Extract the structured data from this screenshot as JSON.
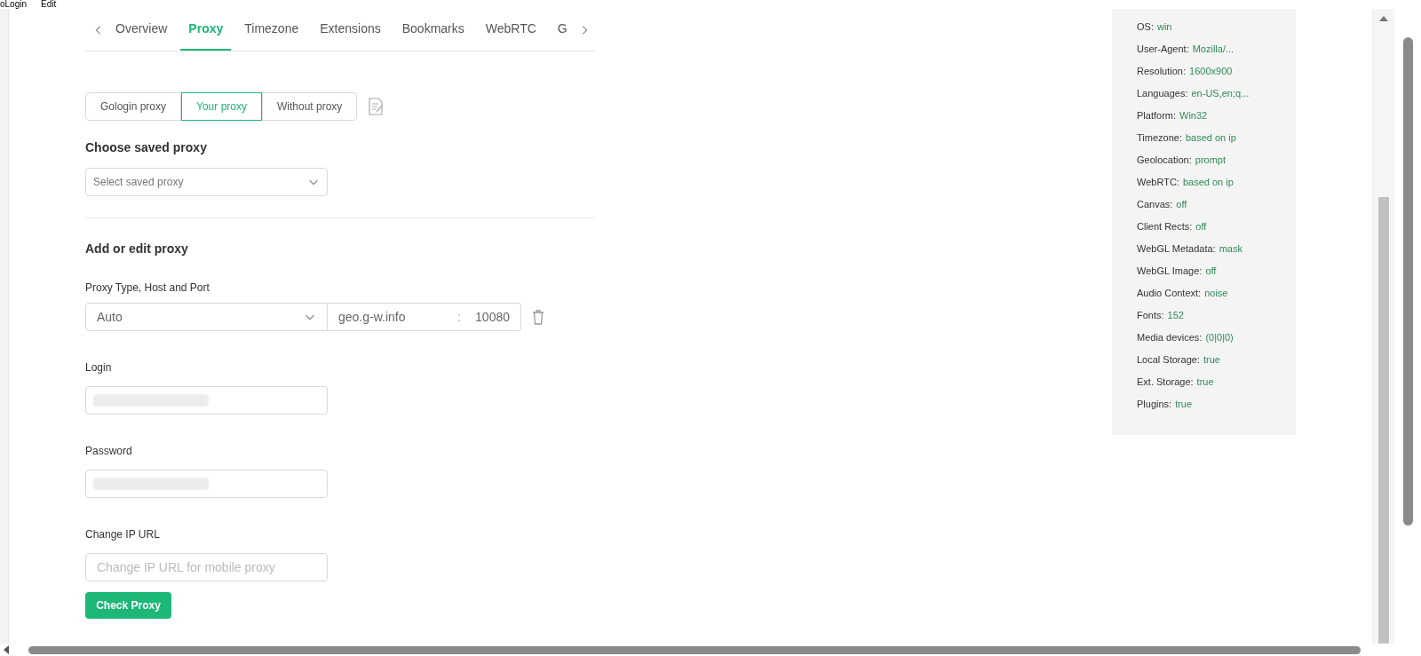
{
  "menu": [
    "oLogin",
    "Edit"
  ],
  "tabs": [
    {
      "label": "Overview",
      "selected": false
    },
    {
      "label": "Proxy",
      "selected": true
    },
    {
      "label": "Timezone",
      "selected": false
    },
    {
      "label": "Extensions",
      "selected": false
    },
    {
      "label": "Bookmarks",
      "selected": false
    },
    {
      "label": "WebRTC",
      "selected": false
    },
    {
      "label": "G",
      "selected": false
    }
  ],
  "proxy_modes": [
    {
      "label": "Gologin proxy",
      "selected": false
    },
    {
      "label": "Your proxy",
      "selected": true
    },
    {
      "label": "Without proxy",
      "selected": false
    }
  ],
  "saved_proxy": {
    "heading": "Choose saved proxy",
    "placeholder": "Select saved proxy"
  },
  "edit": {
    "heading": "Add or edit proxy",
    "type_label": "Proxy Type, Host and Port",
    "type": "Auto",
    "host": "geo.g-w.info",
    "separator": ":",
    "port": "10080",
    "login_label": "Login",
    "password_label": "Password",
    "change_ip_label": "Change IP URL",
    "change_ip_placeholder": "Change IP URL for mobile proxy",
    "check_button": "Check Proxy"
  },
  "fingerprint": [
    {
      "key": "OS:",
      "value": "win"
    },
    {
      "key": "User-Agent:",
      "value": "Mozilla/..."
    },
    {
      "key": "Resolution:",
      "value": "1600x900"
    },
    {
      "key": "Languages:",
      "value": "en-US,en;q..."
    },
    {
      "key": "Platform:",
      "value": "Win32"
    },
    {
      "key": "Timezone:",
      "value": "based on ip"
    },
    {
      "key": "Geolocation:",
      "value": "prompt"
    },
    {
      "key": "WebRTC:",
      "value": "based on ip"
    },
    {
      "key": "Canvas:",
      "value": "off"
    },
    {
      "key": "Client Rects:",
      "value": "off"
    },
    {
      "key": "WebGL Metadata:",
      "value": "mask"
    },
    {
      "key": "WebGL Image:",
      "value": "off"
    },
    {
      "key": "Audio Context:",
      "value": "noise"
    },
    {
      "key": "Fonts:",
      "value": "152"
    },
    {
      "key": "Media devices:",
      "value": "(0|0|0)"
    },
    {
      "key": "Local Storage:",
      "value": "true"
    },
    {
      "key": "Ext. Storage:",
      "value": "true"
    },
    {
      "key": "Plugins:",
      "value": "true"
    }
  ]
}
